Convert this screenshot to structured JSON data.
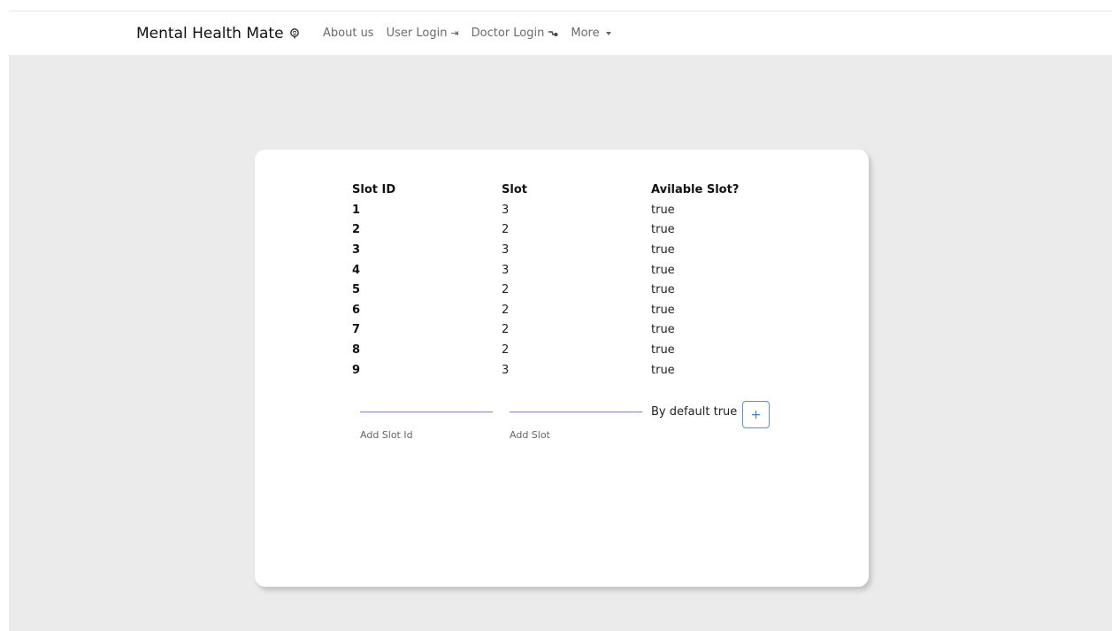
{
  "navbar": {
    "brand": "Mental Health Mate",
    "links": {
      "about": "About us",
      "user_login": "User Login",
      "doctor_login": "Doctor Login",
      "more": "More"
    }
  },
  "table": {
    "headers": {
      "slot_id": "Slot ID",
      "slot": "Slot",
      "available": "Avilable Slot?"
    },
    "rows": [
      {
        "id": "1",
        "slot": "3",
        "available": "true"
      },
      {
        "id": "2",
        "slot": "2",
        "available": "true"
      },
      {
        "id": "3",
        "slot": "3",
        "available": "true"
      },
      {
        "id": "4",
        "slot": "3",
        "available": "true"
      },
      {
        "id": "5",
        "slot": "2",
        "available": "true"
      },
      {
        "id": "6",
        "slot": "2",
        "available": "true"
      },
      {
        "id": "7",
        "slot": "2",
        "available": "true"
      },
      {
        "id": "8",
        "slot": "2",
        "available": "true"
      },
      {
        "id": "9",
        "slot": "3",
        "available": "true"
      }
    ]
  },
  "add_form": {
    "slot_id_label": "Add Slot Id",
    "slot_label": "Add Slot",
    "default_text": "By default true",
    "add_button": "+"
  }
}
